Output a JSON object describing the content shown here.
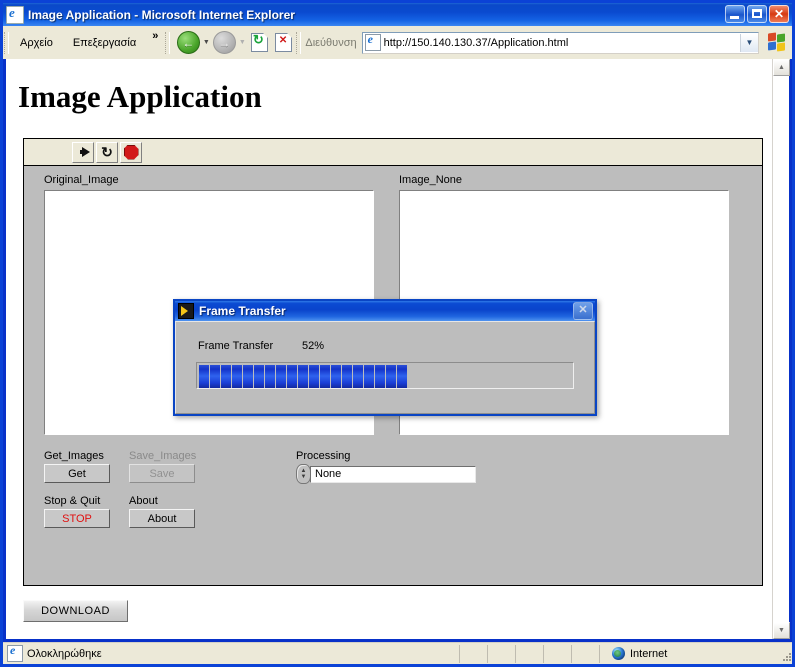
{
  "window": {
    "title": "Image Application - Microsoft Internet Explorer",
    "icon": "ie-page-icon",
    "minimize_label": "Minimize",
    "maximize_label": "Maximize",
    "close_label": "Close"
  },
  "menubar": {
    "items": [
      {
        "label": "Αρχείο"
      },
      {
        "label": "Επεξεργασία"
      }
    ],
    "overflow": "»"
  },
  "toolbar": {
    "back": "Back",
    "forward": "Forward",
    "refresh": "Refresh",
    "stop": "Stop",
    "back_arrow": "←",
    "forward_arrow": "→",
    "dropdown_arrow": "▼"
  },
  "address": {
    "label": "Διεύθυνση",
    "url": "http://150.140.130.37/Application.html",
    "dropdown_arrow": "▼"
  },
  "page": {
    "heading": "Image Application",
    "download_button": "DOWNLOAD"
  },
  "applet": {
    "toolbar": {
      "run": "Run",
      "run_continuously": "Run Continuously",
      "abort": "Abort Execution",
      "loop_glyph": "↻"
    },
    "panels": [
      {
        "label": "Original_Image"
      },
      {
        "label": "Image_None"
      }
    ],
    "controls": {
      "get_images_label": "Get_Images",
      "get_button": "Get",
      "save_images_label": "Save_Images",
      "save_button": "Save",
      "save_enabled": false,
      "stop_quit_label": "Stop & Quit",
      "stop_button": "STOP",
      "stop_color": "#e01010",
      "about_label": "About",
      "about_button": "About",
      "processing_label": "Processing",
      "processing_value": "None",
      "increment_up": "▲",
      "increment_down": "▼"
    }
  },
  "dialog": {
    "title": "Frame Transfer",
    "icon": "labview-icon",
    "close_label": "✕",
    "caption": "Frame Transfer",
    "percent_text": "52%",
    "percent_value": 52,
    "segments": 19,
    "fill_color": "#1433c8"
  },
  "scrollbar": {
    "up_arrow": "▲",
    "down_arrow": "▼"
  },
  "statusbar": {
    "text": "Ολοκληρώθηκε",
    "zone": "Internet",
    "zone_icon": "globe-icon"
  }
}
